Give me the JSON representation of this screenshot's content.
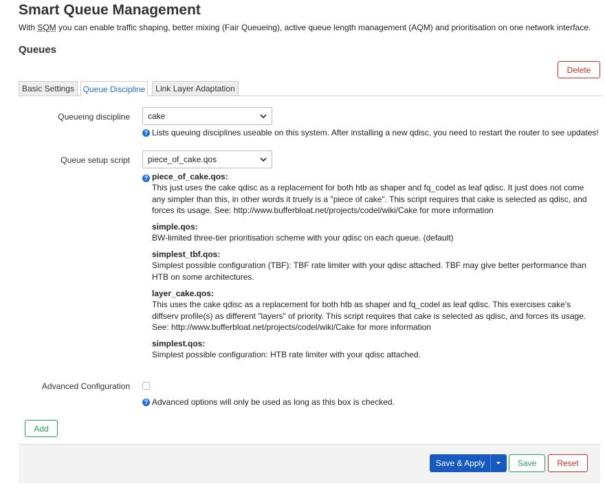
{
  "page": {
    "title": "Smart Queue Management",
    "description_pre": "With ",
    "description_abbr": "SQM",
    "description_post": " you can enable traffic shaping, better mixing (Fair Queueing), active queue length management (AQM) and prioritisation on one network interface.",
    "section_title": "Queues"
  },
  "buttons": {
    "delete": "Delete",
    "add": "Add",
    "save_apply": "Save & Apply",
    "save": "Save",
    "reset": "Reset"
  },
  "tabs": [
    {
      "label": "Basic Settings",
      "active": false
    },
    {
      "label": "Queue Discipline",
      "active": true
    },
    {
      "label": "Link Layer Adaptation",
      "active": false
    }
  ],
  "form": {
    "qdisc": {
      "label": "Queueing discipline",
      "value": "cake",
      "help": "Lists queuing disciplines useable on this system. After installing a new qdisc, you need to restart the router to see updates!"
    },
    "script": {
      "label": "Queue setup script",
      "value": "piece_of_cake.qos",
      "descriptions": [
        {
          "name": "piece_of_cake.qos:",
          "text": "This just uses the cake qdisc as a replacement for both htb as shaper and fq_codel as leaf qdisc. It just does not come any simpler than this, in other words it truely is a \"piece of cake\". This script requires that cake is selected as qdisc, and forces its usage. See: http://www.bufferbloat.net/projects/codel/wiki/Cake for more information"
        },
        {
          "name": "simple.qos:",
          "text": "BW-limited three-tier prioritisation scheme with your qdisc on each queue. (default)"
        },
        {
          "name": "simplest_tbf.qos:",
          "text": "Simplest possible configuration (TBF): TBF rate limiter with your qdisc attached. TBF may give better performance than HTB on some architectures."
        },
        {
          "name": "layer_cake.qos:",
          "text": "This uses the cake qdisc as a replacement for both htb as shaper and fq_codel as leaf qdisc. This exercises cake's diffserv profile(s) as different \"layers\" of priority. This script requires that cake is selected as qdisc, and forces its usage. See: http://www.bufferbloat.net/projects/codel/wiki/Cake for more information"
        },
        {
          "name": "simplest.qos:",
          "text": "Simplest possible configuration: HTB rate limiter with your qdisc attached."
        }
      ]
    },
    "advanced": {
      "label": "Advanced Configuration",
      "checked": false,
      "help": "Advanced options will only be used as long as this box is checked."
    }
  },
  "icons": {
    "help": "?"
  },
  "colors": {
    "primary": "#1659c0",
    "positive": "#2a9e5c",
    "negative": "#c9302c",
    "active_tab": "#2a6ebb"
  }
}
